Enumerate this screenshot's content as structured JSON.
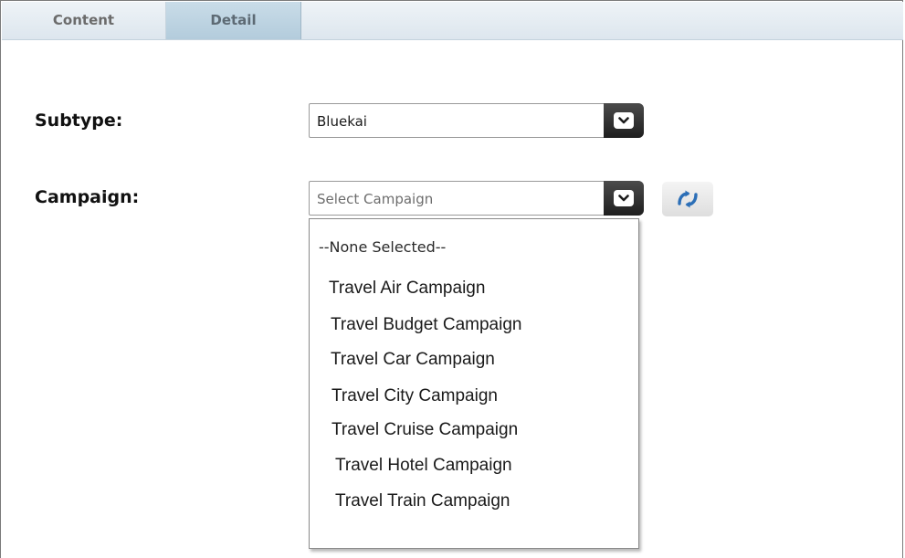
{
  "tabs": {
    "content_label": "Content",
    "detail_label": "Detail"
  },
  "subtype": {
    "label": "Subtype:",
    "value": "Bluekai"
  },
  "campaign": {
    "label": "Campaign:",
    "placeholder": "Select Campaign",
    "options": [
      "--None Selected--",
      "Travel Air Campaign",
      "Travel Budget Campaign",
      "Travel Car Campaign",
      "Travel City Campaign",
      "Travel Cruise Campaign",
      "Travel Hotel Campaign",
      "Travel Train Campaign"
    ]
  },
  "icons": {
    "dropdown_arrow": "chevron-down-icon",
    "refresh": "refresh-icon"
  },
  "colors": {
    "active_tab": "#b9d0df",
    "tab_bar": "#e3eaf0",
    "refresh_arrows": "#2c6fb7",
    "select_arrow_bg": "#2b2b2b"
  }
}
